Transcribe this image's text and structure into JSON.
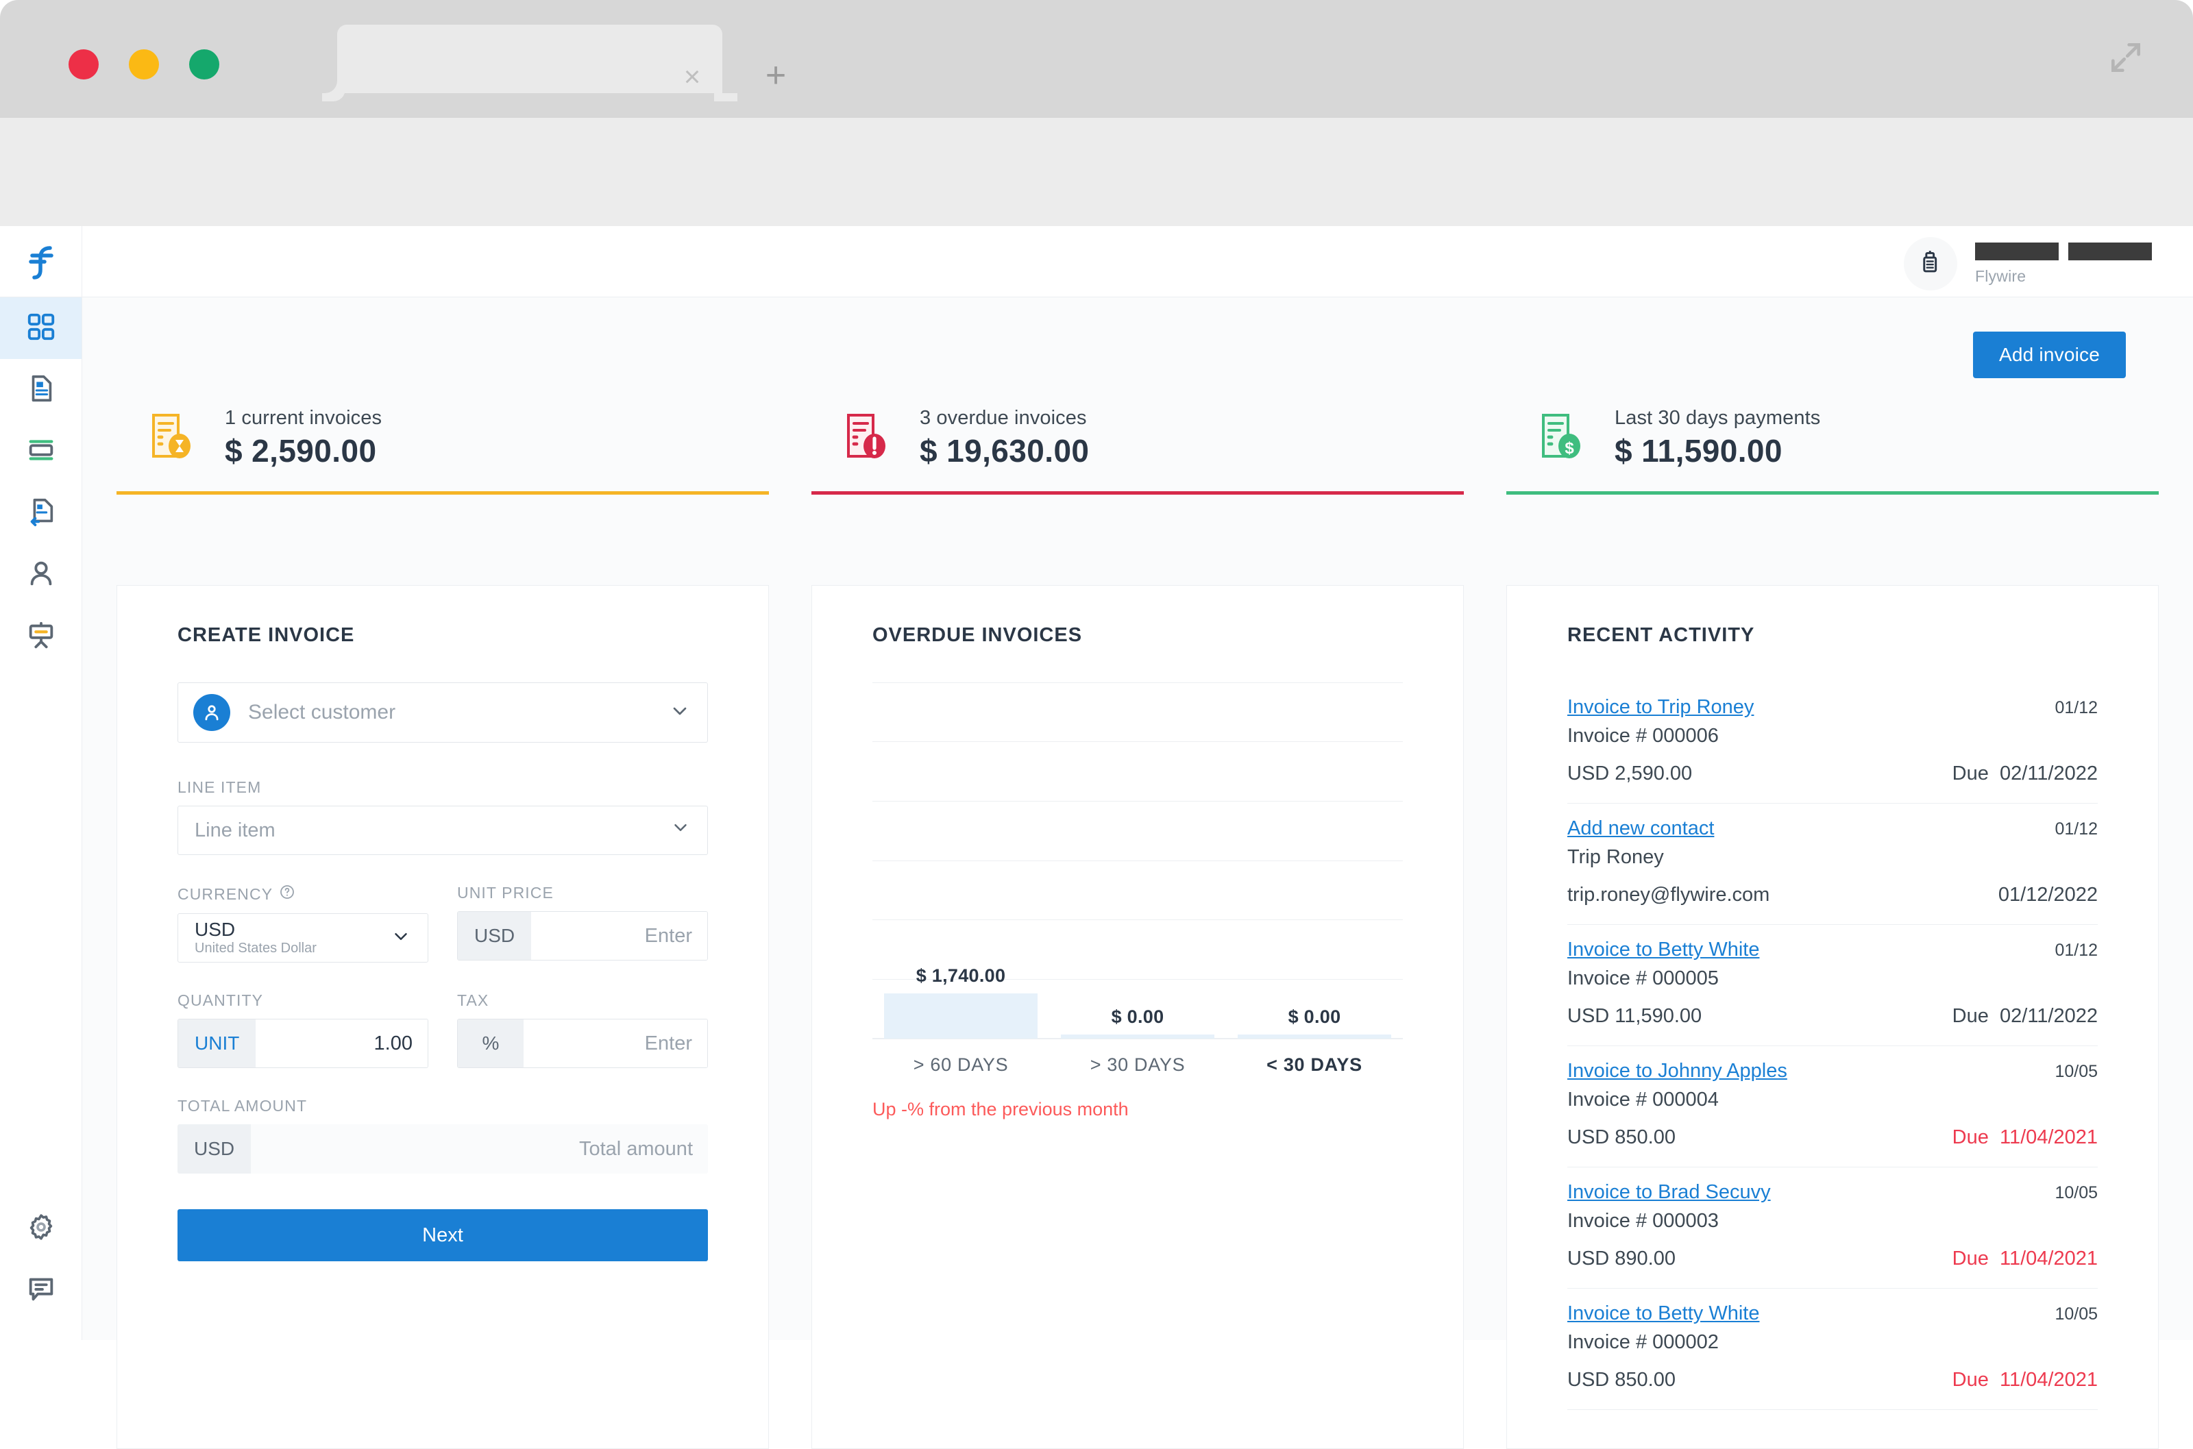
{
  "browser": {
    "tab_close_label": "×",
    "new_tab_label": "+",
    "address_value": "",
    "icons": {
      "back": "back-arrow-icon",
      "forward": "forward-arrow-icon",
      "reload": "reload-icon",
      "search": "search-icon",
      "menu": "kebab-menu-icon",
      "expand": "expand-icon"
    }
  },
  "sidebar": {
    "logo": "flywire-logo",
    "items": [
      {
        "name": "dashboard",
        "icon": "grid-icon",
        "active": true
      },
      {
        "name": "invoices",
        "icon": "document-icon",
        "active": false
      },
      {
        "name": "payments",
        "icon": "card-icon",
        "active": false
      },
      {
        "name": "refunds",
        "icon": "document-return-icon",
        "active": false
      },
      {
        "name": "contacts",
        "icon": "person-icon",
        "active": false
      },
      {
        "name": "reports",
        "icon": "presentation-icon",
        "active": false
      }
    ],
    "bottom_items": [
      {
        "name": "settings",
        "icon": "gear-icon"
      },
      {
        "name": "support",
        "icon": "chat-icon"
      }
    ]
  },
  "topbar": {
    "account_icon": "building-icon",
    "account_name_redacted": true,
    "org": "Flywire"
  },
  "toolbar": {
    "add_invoice_label": "Add invoice"
  },
  "kpis": [
    {
      "label": "1 current invoices",
      "value": "$ 2,590.00",
      "icon": "invoice-pending-icon",
      "color": "#f5b426"
    },
    {
      "label": "3 overdue invoices",
      "value": "$ 19,630.00",
      "icon": "invoice-overdue-icon",
      "color": "#d6294a"
    },
    {
      "label": "Last 30 days payments",
      "value": "$ 11,590.00",
      "icon": "invoice-paid-icon",
      "color": "#3fbd7f"
    }
  ],
  "create_invoice": {
    "title": "CREATE INVOICE",
    "customer_placeholder": "Select customer",
    "line_item_label": "LINE ITEM",
    "line_item_placeholder": "Line item",
    "currency_label": "CURRENCY",
    "currency_code": "USD",
    "currency_name": "United States Dollar",
    "unit_price_label": "UNIT PRICE",
    "unit_price_addon": "USD",
    "unit_price_placeholder": "Enter",
    "quantity_label": "QUANTITY",
    "quantity_addon": "UNIT",
    "quantity_value": "1.00",
    "tax_label": "TAX",
    "tax_addon": "%",
    "tax_placeholder": "Enter",
    "total_label": "TOTAL AMOUNT",
    "total_addon": "USD",
    "total_placeholder": "Total amount",
    "next_label": "Next"
  },
  "overdue_panel": {
    "title": "OVERDUE INVOICES",
    "footnote": "Up -% from the previous month"
  },
  "chart_data": {
    "type": "bar",
    "title": "OVERDUE INVOICES",
    "categories": [
      "> 60 DAYS",
      "> 30 DAYS",
      "< 30 DAYS"
    ],
    "values": [
      1740.0,
      0.0,
      0.0
    ],
    "value_labels": [
      "$ 1,740.00",
      "$ 0.00",
      "$ 0.00"
    ],
    "highlighted_category": "< 30 DAYS",
    "xlabel": "",
    "ylabel": "",
    "ylim": [
      0,
      26100
    ],
    "grid": true,
    "gridlines": 6,
    "legend": "none",
    "bar_color": "#e6f1fa",
    "annotation": "Up -% from the previous month"
  },
  "recent_activity": {
    "title": "RECENT ACTIVITY",
    "items": [
      {
        "link": "Invoice to Trip Roney",
        "date": "01/12",
        "sub": "Invoice # 000006",
        "amount": "USD 2,590.00",
        "due_prefix": "Due",
        "due_date": "02/11/2022",
        "overdue": false
      },
      {
        "link": "Add new contact",
        "date": "01/12",
        "sub": "Trip Roney",
        "amount": "trip.roney@flywire.com",
        "due_prefix": "",
        "due_date": "01/12/2022",
        "overdue": false
      },
      {
        "link": "Invoice to Betty White",
        "date": "01/12",
        "sub": "Invoice # 000005",
        "amount": "USD 11,590.00",
        "due_prefix": "Due",
        "due_date": "02/11/2022",
        "overdue": false
      },
      {
        "link": "Invoice to Johnny Apples",
        "date": "10/05",
        "sub": "Invoice # 000004",
        "amount": "USD 850.00",
        "due_prefix": "Due",
        "due_date": "11/04/2021",
        "overdue": true
      },
      {
        "link": "Invoice to Brad Secuvy",
        "date": "10/05",
        "sub": "Invoice # 000003",
        "amount": "USD 890.00",
        "due_prefix": "Due",
        "due_date": "11/04/2021",
        "overdue": true
      },
      {
        "link": "Invoice to Betty White",
        "date": "10/05",
        "sub": "Invoice # 000002",
        "amount": "USD 850.00",
        "due_prefix": "Due",
        "due_date": "11/04/2021",
        "overdue": true
      }
    ]
  },
  "colors": {
    "accent_blue": "#1a7fd4",
    "amber": "#f5b426",
    "red": "#d6294a",
    "green": "#3fbd7f",
    "overdue_red": "#ed3a4f",
    "chart_bar": "#e6f1fa"
  }
}
